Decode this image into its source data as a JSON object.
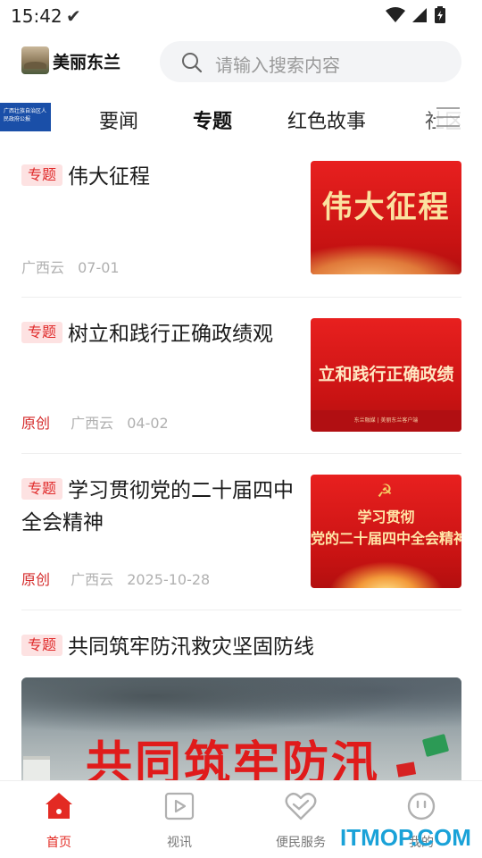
{
  "status_bar": {
    "time": "15:42",
    "check_glyph": "✔"
  },
  "header": {
    "app_name": "美丽东兰",
    "logo_icon": "mountain-logo-icon",
    "search_placeholder": "请输入搜索内容"
  },
  "gov_badge": {
    "text": "广西壮族自治区人民政府公报"
  },
  "tabs": [
    {
      "label": "要闻",
      "active": false
    },
    {
      "label": "专题",
      "active": true
    },
    {
      "label": "红色故事",
      "active": false
    },
    {
      "label": "社区",
      "active": false
    }
  ],
  "feed": [
    {
      "tag": "专题",
      "title": "伟大征程",
      "original": "",
      "source": "广西云",
      "date": "07-01",
      "thumb_text": "伟大征程"
    },
    {
      "tag": "专题",
      "title": "树立和践行正确政绩观",
      "original": "原创",
      "source": "广西云",
      "date": "04-02",
      "thumb_text": "立和践行正确政绩",
      "thumb_footer": "东兰融媒 | 美丽东兰客户端"
    },
    {
      "tag": "专题",
      "title": "学习贯彻党的二十届四中全会精神",
      "original": "原创",
      "source": "广西云",
      "date": "2025-10-28",
      "thumb_line1": "学习贯彻",
      "thumb_line2": "党的二十届四中全会精神"
    },
    {
      "tag": "专题",
      "title": "共同筑牢防汛救灾坚固防线",
      "banner_text": "共同筑牢防汛"
    }
  ],
  "bottom_nav": [
    {
      "label": "首页",
      "icon": "home-icon",
      "active": true
    },
    {
      "label": "视讯",
      "icon": "play-icon",
      "active": false
    },
    {
      "label": "便民服务",
      "icon": "heart-service-icon",
      "active": false
    },
    {
      "label": "我的",
      "icon": "face-icon",
      "active": false
    }
  ],
  "watermark": "ITMOP.COM",
  "colors": {
    "accent": "#e32a23",
    "tag_bg": "#fde2e2",
    "search_bg": "#f3f4f6"
  }
}
